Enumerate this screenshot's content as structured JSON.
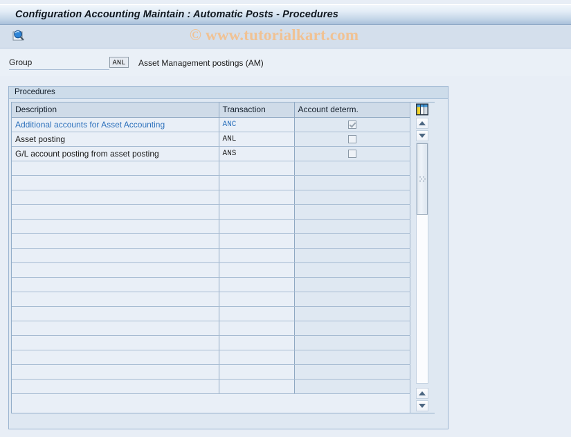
{
  "window": {
    "title": "Configuration Accounting Maintain : Automatic Posts - Procedures"
  },
  "toolbar": {
    "display_button_label": "",
    "display_icon": "magnifier-display-icon"
  },
  "watermark": {
    "text": "© www.tutorialkart.com"
  },
  "group": {
    "label": "Group",
    "code": "ANL",
    "description": "Asset Management postings (AM)"
  },
  "panel": {
    "title": "Procedures"
  },
  "table": {
    "columns": [
      "Description",
      "Transaction",
      "Account determ."
    ],
    "rows": [
      {
        "description": "Additional accounts for Asset Accounting",
        "transaction": "ANC",
        "account_determ": true,
        "active": true
      },
      {
        "description": "Asset posting",
        "transaction": "ANL",
        "account_determ": false,
        "active": false
      },
      {
        "description": "G/L account posting from asset posting",
        "transaction": "ANS",
        "account_determ": false,
        "active": false
      }
    ],
    "empty_row_count": 16
  },
  "scrollbar": {
    "settings_icon": "table-settings-icon",
    "up_arrow": "scroll-up-icon",
    "down_arrow": "scroll-down-icon",
    "page_up_arrow": "page-up-icon",
    "page_down_arrow": "page-down-icon"
  },
  "colors": {
    "titlebar_top": "#f2f7fc",
    "titlebar_bottom": "#a9c0da",
    "toolbar": "#d4dfec",
    "page_background": "#e8eef6",
    "grid_row": "#e9eff7",
    "grid_alt_col": "#dfe8f2",
    "link_text": "#2a6fbb",
    "watermark": "#f0c294"
  }
}
